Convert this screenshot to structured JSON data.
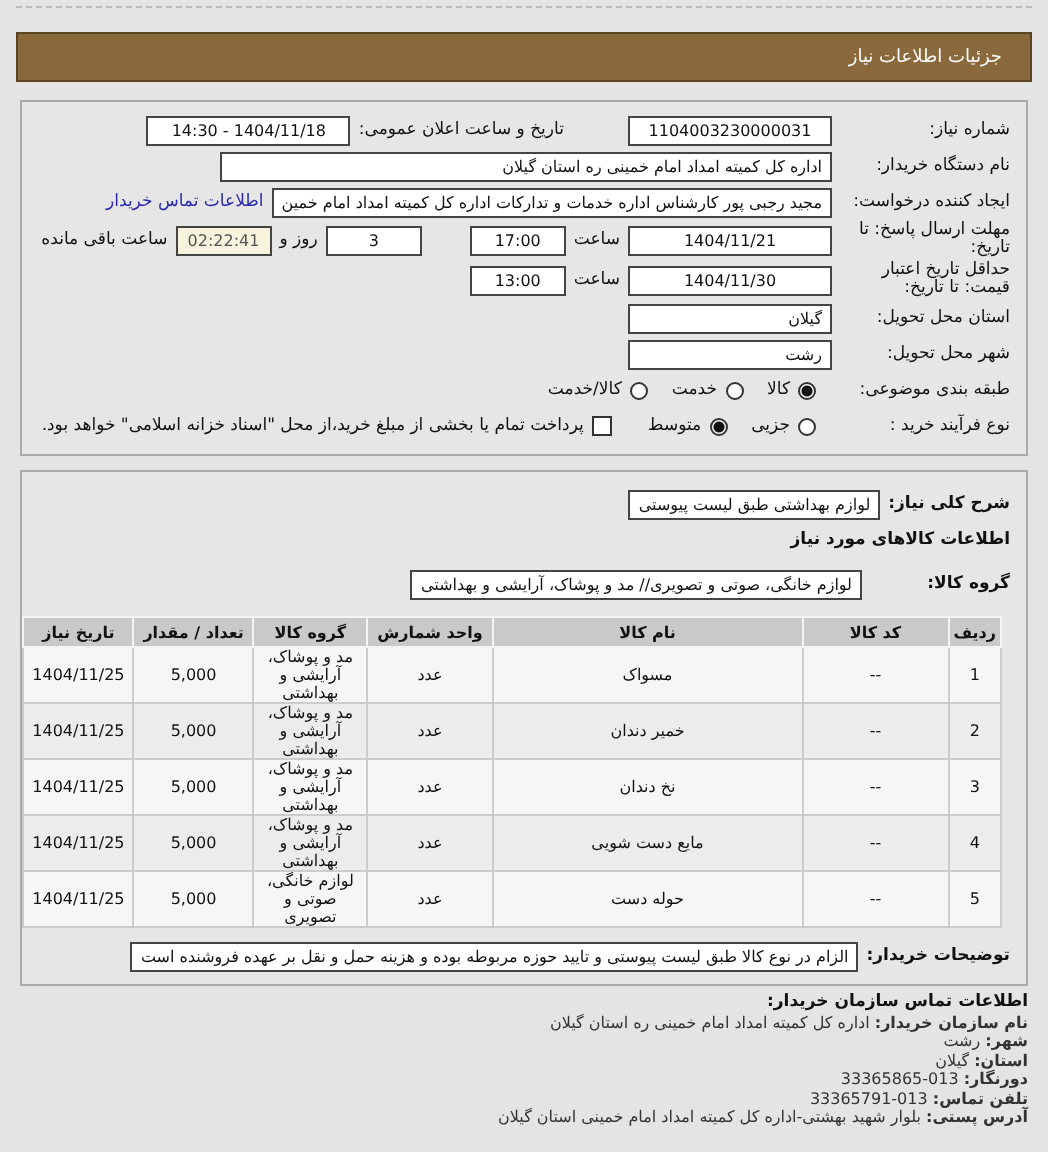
{
  "header": {
    "title": "جزئیات اطلاعات نیاز"
  },
  "details": {
    "need_number": {
      "label": "شماره نیاز:",
      "value": "1104003230000031"
    },
    "announce": {
      "label": "تاریخ و ساعت اعلان عمومی:",
      "value": "1404/11/18 - 14:30"
    },
    "buyer": {
      "label": "نام دستگاه خریدار:",
      "value": "اداره کل کمیته امداد امام خمینی  ره  استان گیلان"
    },
    "creator": {
      "label": "ایجاد کننده درخواست:",
      "value": "مجید رجبی پور کارشناس اداره خدمات و تدارکات اداره کل کمیته امداد امام خمین",
      "link": "اطلاعات تماس خریدار"
    },
    "deadline": {
      "label": "مهلت ارسال پاسخ: تا تاریخ:",
      "date": "1404/11/21",
      "time_label": "ساعت",
      "time": "17:00",
      "days": "3",
      "days_label": "روز و",
      "remaining": "02:22:41",
      "remaining_label": "ساعت باقی مانده"
    },
    "validity": {
      "label": "حداقل تاریخ اعتبار قیمت: تا تاریخ:",
      "date": "1404/11/30",
      "time_label": "ساعت",
      "time": "13:00"
    },
    "province": {
      "label": "استان محل تحویل:",
      "value": "گیلان"
    },
    "city": {
      "label": "شهر محل تحویل:",
      "value": "رشت"
    },
    "category": {
      "label": "طبقه بندی موضوعی:",
      "options": [
        {
          "label": "کالا",
          "selected": true
        },
        {
          "label": "خدمت",
          "selected": false
        },
        {
          "label": "کالا/خدمت",
          "selected": false
        }
      ]
    },
    "process": {
      "label": "نوع فرآیند خرید :",
      "options": [
        {
          "label": "جزیی",
          "selected": false
        },
        {
          "label": "متوسط",
          "selected": true
        }
      ],
      "treasury": {
        "checked": false,
        "text": "پرداخت تمام یا بخشی از مبلغ خرید،از محل \"اسناد خزانه اسلامی\" خواهد بود."
      }
    }
  },
  "summary": {
    "label": "شرح کلی نیاز:",
    "value": "لوازم بهداشتی طبق لیست پیوستی"
  },
  "goods_title": "اطلاعات کالاهای مورد نیاز",
  "group": {
    "label": "گروه کالا:",
    "value": "لوازم خانگی، صوتی و تصویری// مد و پوشاک، آرایشی و بهداشتی"
  },
  "table": {
    "columns": [
      "ردیف",
      "کد کالا",
      "نام کالا",
      "واحد شمارش",
      "گروه کالا",
      "تعداد / مقدار",
      "تاریخ نیاز"
    ],
    "rows": [
      [
        "1",
        "--",
        "مسواک",
        "عدد",
        "مد و پوشاک، آرایشی و بهداشتی",
        "5,000",
        "1404/11/25"
      ],
      [
        "2",
        "--",
        "خمیر دندان",
        "عدد",
        "مد و پوشاک، آرایشی و بهداشتی",
        "5,000",
        "1404/11/25"
      ],
      [
        "3",
        "--",
        "نخ دندان",
        "عدد",
        "مد و پوشاک، آرایشی و بهداشتی",
        "5,000",
        "1404/11/25"
      ],
      [
        "4",
        "--",
        "مایع دست شویی",
        "عدد",
        "مد و پوشاک، آرایشی و بهداشتی",
        "5,000",
        "1404/11/25"
      ],
      [
        "5",
        "--",
        "حوله دست",
        "عدد",
        "لوازم خانگی، صوتی و تصویری",
        "5,000",
        "1404/11/25"
      ]
    ]
  },
  "notes": {
    "label": "توضیحات خریدار:",
    "value": "الزام در نوع کالا طبق لیست پیوستی و تایید حوزه مربوطه بوده و هزینه حمل و نقل بر عهده فروشنده است"
  },
  "contact": {
    "title": "اطلاعات تماس سازمان خریدار:",
    "lines": [
      "**نام سازمان خریدار:** اداره کل کمیته امداد امام خمینی ره استان گیلان",
      "**شهر:** رشت",
      "**استان:** گیلان",
      "**دورنگار:** 013-33365865",
      "**تلفن تماس:** 013-33365791",
      "**آدرس پستی:** بلوار شهید بهشتی-اداره کل کمیته امداد امام خمینی استان گیلان"
    ]
  }
}
